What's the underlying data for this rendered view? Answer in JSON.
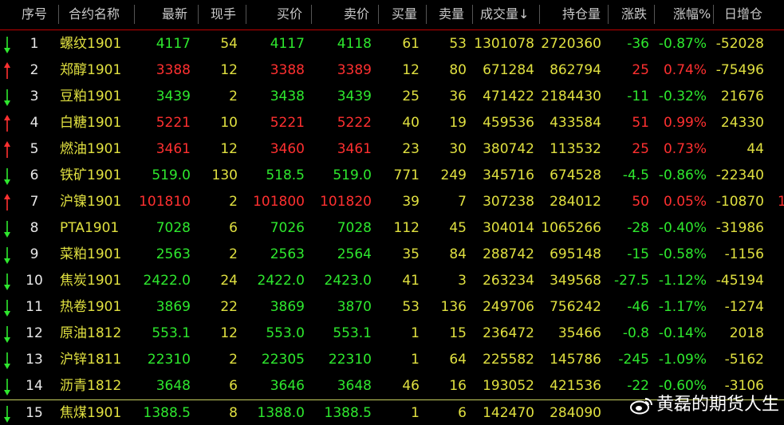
{
  "header": {
    "seq": "序号",
    "name": "合约名称",
    "last": "最新",
    "vol_now": "现手",
    "bid": "买价",
    "ask": "卖价",
    "bid_qty": "买量",
    "ask_qty": "卖量",
    "volume": "成交量↓",
    "open_interest": "持仓量",
    "change": "涨跌",
    "change_pct": "涨幅%",
    "oi_change": "日增仓"
  },
  "rows": [
    {
      "dir": "down",
      "seq": "1",
      "name": "螺纹1901",
      "last": "4117",
      "vol_now": "54",
      "bid": "4117",
      "ask": "4118",
      "bid_qty": "61",
      "ask_qty": "53",
      "volume": "1301078",
      "open_interest": "2720360",
      "change": "-36",
      "change_pct": "-0.87%",
      "oi_change": "-52028"
    },
    {
      "dir": "up",
      "seq": "2",
      "name": "郑醇1901",
      "last": "3388",
      "vol_now": "12",
      "bid": "3388",
      "ask": "3389",
      "bid_qty": "12",
      "ask_qty": "80",
      "volume": "671284",
      "open_interest": "862794",
      "change": "25",
      "change_pct": "0.74%",
      "oi_change": "-75496"
    },
    {
      "dir": "down",
      "seq": "3",
      "name": "豆粕1901",
      "last": "3439",
      "vol_now": "2",
      "bid": "3438",
      "ask": "3439",
      "bid_qty": "25",
      "ask_qty": "36",
      "volume": "471422",
      "open_interest": "2184430",
      "change": "-11",
      "change_pct": "-0.32%",
      "oi_change": "21676"
    },
    {
      "dir": "up",
      "seq": "4",
      "name": "白糖1901",
      "last": "5221",
      "vol_now": "10",
      "bid": "5221",
      "ask": "5222",
      "bid_qty": "40",
      "ask_qty": "19",
      "volume": "459536",
      "open_interest": "433584",
      "change": "51",
      "change_pct": "0.99%",
      "oi_change": "24330"
    },
    {
      "dir": "up",
      "seq": "5",
      "name": "燃油1901",
      "last": "3461",
      "vol_now": "12",
      "bid": "3460",
      "ask": "3461",
      "bid_qty": "23",
      "ask_qty": "30",
      "volume": "380742",
      "open_interest": "113532",
      "change": "25",
      "change_pct": "0.73%",
      "oi_change": "44"
    },
    {
      "dir": "down",
      "seq": "6",
      "name": "铁矿1901",
      "last": "519.0",
      "vol_now": "130",
      "bid": "518.5",
      "ask": "519.0",
      "bid_qty": "771",
      "ask_qty": "249",
      "volume": "345716",
      "open_interest": "674528",
      "change": "-4.5",
      "change_pct": "-0.86%",
      "oi_change": "-22340"
    },
    {
      "dir": "up",
      "seq": "7",
      "name": "沪镍1901",
      "last": "101810",
      "vol_now": "2",
      "bid": "101800",
      "ask": "101820",
      "bid_qty": "39",
      "ask_qty": "7",
      "volume": "307238",
      "open_interest": "284012",
      "change": "50",
      "change_pct": "0.05%",
      "oi_change": "-10870"
    },
    {
      "dir": "down",
      "seq": "8",
      "name": "PTA1901",
      "last": "7028",
      "vol_now": "6",
      "bid": "7026",
      "ask": "7028",
      "bid_qty": "112",
      "ask_qty": "45",
      "volume": "304014",
      "open_interest": "1065266",
      "change": "-28",
      "change_pct": "-0.40%",
      "oi_change": "-31986"
    },
    {
      "dir": "down",
      "seq": "9",
      "name": "菜粕1901",
      "last": "2563",
      "vol_now": "2",
      "bid": "2563",
      "ask": "2564",
      "bid_qty": "35",
      "ask_qty": "84",
      "volume": "288742",
      "open_interest": "695148",
      "change": "-15",
      "change_pct": "-0.58%",
      "oi_change": "-1156"
    },
    {
      "dir": "down",
      "seq": "10",
      "name": "焦炭1901",
      "last": "2422.0",
      "vol_now": "24",
      "bid": "2422.0",
      "ask": "2423.0",
      "bid_qty": "41",
      "ask_qty": "3",
      "volume": "263234",
      "open_interest": "349568",
      "change": "-27.5",
      "change_pct": "-1.12%",
      "oi_change": "-45194"
    },
    {
      "dir": "down",
      "seq": "11",
      "name": "热卷1901",
      "last": "3869",
      "vol_now": "22",
      "bid": "3869",
      "ask": "3870",
      "bid_qty": "53",
      "ask_qty": "136",
      "volume": "249706",
      "open_interest": "756242",
      "change": "-46",
      "change_pct": "-1.17%",
      "oi_change": "-1274"
    },
    {
      "dir": "down",
      "seq": "12",
      "name": "原油1812",
      "last": "553.1",
      "vol_now": "12",
      "bid": "553.0",
      "ask": "553.1",
      "bid_qty": "1",
      "ask_qty": "15",
      "volume": "236472",
      "open_interest": "35466",
      "change": "-0.8",
      "change_pct": "-0.14%",
      "oi_change": "2018"
    },
    {
      "dir": "down",
      "seq": "13",
      "name": "沪锌1811",
      "last": "22310",
      "vol_now": "2",
      "bid": "22305",
      "ask": "22310",
      "bid_qty": "1",
      "ask_qty": "64",
      "volume": "225582",
      "open_interest": "145786",
      "change": "-245",
      "change_pct": "-1.09%",
      "oi_change": "-5162"
    },
    {
      "dir": "down",
      "seq": "14",
      "name": "沥青1812",
      "last": "3648",
      "vol_now": "6",
      "bid": "3646",
      "ask": "3648",
      "bid_qty": "46",
      "ask_qty": "16",
      "volume": "193052",
      "open_interest": "421536",
      "change": "-22",
      "change_pct": "-0.60%",
      "oi_change": "-3106"
    },
    {
      "dir": "down",
      "seq": "15",
      "name": "焦煤1901",
      "last": "1388.5",
      "vol_now": "8",
      "bid": "1388.0",
      "ask": "1388.5",
      "bid_qty": "1",
      "ask_qty": "6",
      "volume": "142470",
      "open_interest": "284090",
      "change": "",
      "change_pct": "",
      "oi_change": ""
    }
  ],
  "watermark": "黄磊的期货人生",
  "overflow_fragment": "1",
  "colors": {
    "up": "#ff3030",
    "down": "#2ee82e",
    "neutral": "#e8e8e8",
    "label": "#e0e040",
    "header": "#c8c8c8",
    "accent_line": "#c00000"
  },
  "icons": {
    "up": "up-arrow-icon",
    "down": "down-arrow-icon",
    "watermark": "weibo-logo-icon"
  }
}
